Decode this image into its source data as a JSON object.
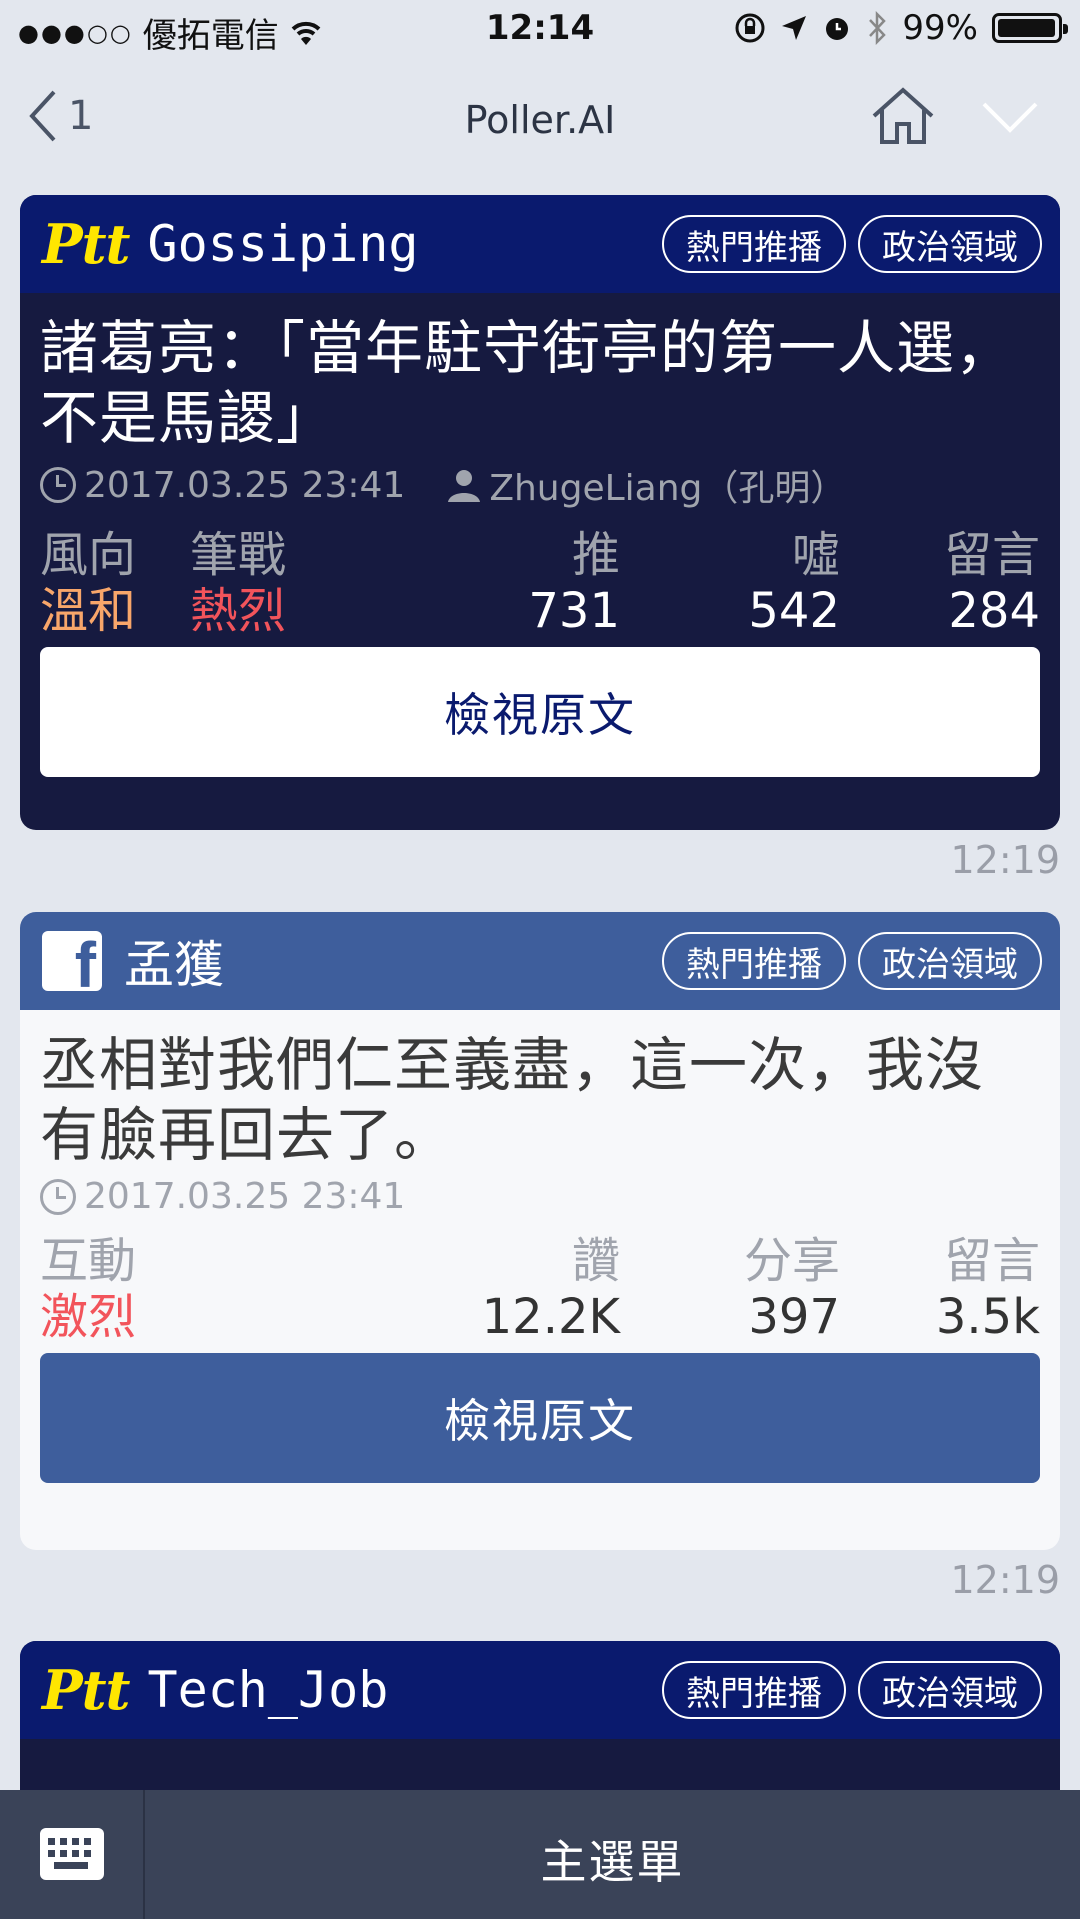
{
  "status_bar": {
    "carrier": "優拓電信",
    "time": "12:14",
    "battery": "99%"
  },
  "nav": {
    "back_count": "1",
    "title": "Poller.AI"
  },
  "cards": [
    {
      "type": "ptt",
      "logo": "Ptt",
      "board": "Gossiping",
      "tags": [
        "熱門推播",
        "政治領域"
      ],
      "title": "諸葛亮：「當年駐守街亭的第一人選，不是馬謖」",
      "date": "2017.03.25 23:41",
      "author": "ZhugeLiang（孔明）",
      "stats": [
        {
          "label": "風向",
          "value": "溫和"
        },
        {
          "label": "筆戰",
          "value": "熱烈"
        },
        {
          "label": "推",
          "value": "731"
        },
        {
          "label": "噓",
          "value": "542"
        },
        {
          "label": "留言",
          "value": "284"
        }
      ],
      "button": "檢視原文",
      "time": "12:19"
    },
    {
      "type": "facebook",
      "name": "孟獲",
      "tags": [
        "熱門推播",
        "政治領域"
      ],
      "title": "丞相對我們仁至義盡，這一次，我沒有臉再回去了。",
      "date": "2017.03.25 23:41",
      "stats": [
        {
          "label": "互動",
          "value": "激烈"
        },
        {
          "label": "讚",
          "value": "12.2K"
        },
        {
          "label": "分享",
          "value": "397"
        },
        {
          "label": "留言",
          "value": "3.5k"
        }
      ],
      "button": "檢視原文",
      "time": "12:19"
    },
    {
      "type": "ptt",
      "logo": "Ptt",
      "board": "Tech_Job",
      "tags": [
        "熱門推播",
        "政治領域"
      ]
    }
  ],
  "bottom_bar": {
    "menu": "主選單"
  },
  "colors": {
    "ptt_header": "#0a1a6e",
    "ptt_body": "#161a40",
    "fb_header": "#3e5e9c",
    "fb_body": "#f7f8fa",
    "accent_orange": "#f8a66a",
    "accent_red": "#f2545b"
  }
}
